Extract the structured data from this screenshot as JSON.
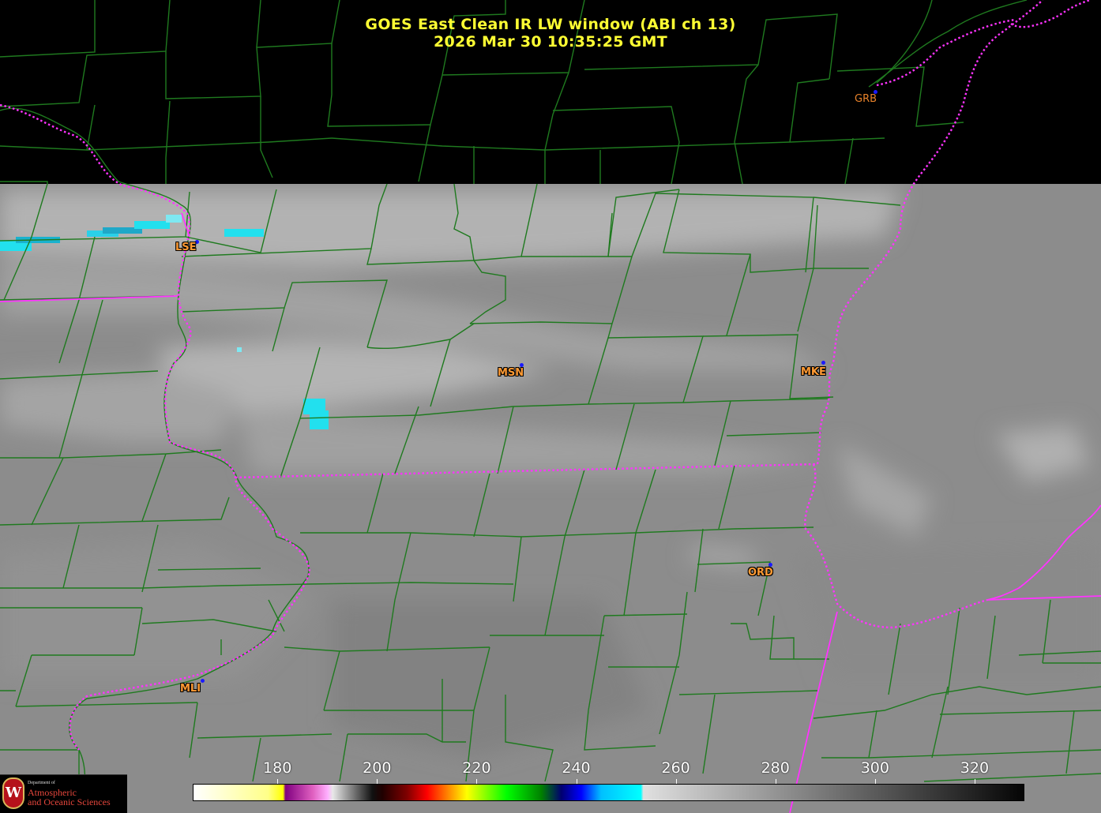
{
  "title": {
    "line1": "GOES East Clean IR LW window (ABI ch 13)",
    "line2": "2026 Mar 30  10:35:25 GMT"
  },
  "stations": [
    {
      "id": "GRB",
      "label": "GRB"
    },
    {
      "id": "LSE",
      "label": "LSE"
    },
    {
      "id": "MSN",
      "label": "MSN"
    },
    {
      "id": "MKE",
      "label": "MKE"
    },
    {
      "id": "ORD",
      "label": "ORD"
    },
    {
      "id": "MLI",
      "label": "MLI"
    }
  ],
  "colorbar": {
    "ticks": [
      "180",
      "200",
      "220",
      "240",
      "260",
      "280",
      "300",
      "320"
    ],
    "min": 163,
    "max": 330,
    "stops": [
      {
        "v": 163,
        "c": "#ffffff"
      },
      {
        "v": 178,
        "c": "#ffff88"
      },
      {
        "v": 181,
        "c": "#ffff00"
      },
      {
        "v": 181.5,
        "c": "#800080"
      },
      {
        "v": 187,
        "c": "#e060c0"
      },
      {
        "v": 190,
        "c": "#ffb0ff"
      },
      {
        "v": 191,
        "c": "#e8e8e8"
      },
      {
        "v": 199,
        "c": "#101010"
      },
      {
        "v": 201,
        "c": "#200000"
      },
      {
        "v": 206,
        "c": "#800000"
      },
      {
        "v": 210,
        "c": "#ff0000"
      },
      {
        "v": 214,
        "c": "#ff8000"
      },
      {
        "v": 218,
        "c": "#ffff00"
      },
      {
        "v": 226,
        "c": "#00ff00"
      },
      {
        "v": 233,
        "c": "#008000"
      },
      {
        "v": 237,
        "c": "#000070"
      },
      {
        "v": 241,
        "c": "#0000ff"
      },
      {
        "v": 245,
        "c": "#00c0ff"
      },
      {
        "v": 253,
        "c": "#00ffff"
      },
      {
        "v": 253.5,
        "c": "#e0e0e0"
      },
      {
        "v": 330,
        "c": "#050505"
      }
    ]
  },
  "colors": {
    "cloud_black": "#000000",
    "ir_gray": "#8c8c8c",
    "county_lines": "#1f7a1f",
    "state_lines": "#ff33ff",
    "title": "#ffff33",
    "station_label": "#ff9a33",
    "station_dot": "#1a1aff",
    "cold_cloud": "#22e0ee"
  },
  "logo": {
    "seal": "W",
    "line1": "Department of",
    "line2": "Atmospheric",
    "line3": "and Oceanic Sciences"
  }
}
